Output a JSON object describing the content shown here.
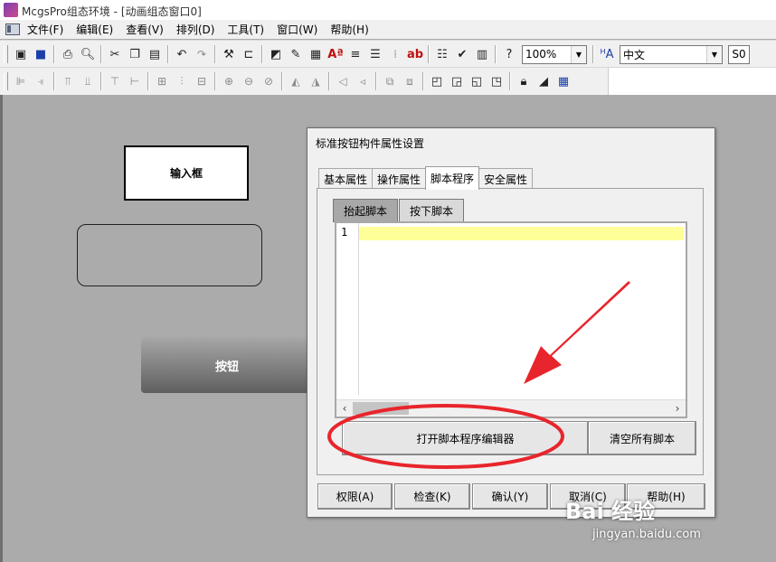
{
  "window": {
    "title": "McgsPro组态环境 - [动画组态窗口0]"
  },
  "menu": [
    "文件(F)",
    "编辑(E)",
    "查看(V)",
    "排列(D)",
    "工具(T)",
    "窗口(W)",
    "帮助(H)"
  ],
  "toolbar": {
    "zoom": "100%",
    "language": "中文",
    "so_label": "S0"
  },
  "canvas": {
    "input_box_label": "输入框",
    "button_label": "按钮"
  },
  "dialog": {
    "title": "标准按钮构件属性设置",
    "tabs": [
      "基本属性",
      "操作属性",
      "脚本程序",
      "安全属性"
    ],
    "active_tab": "脚本程序",
    "subtabs": [
      "抬起脚本",
      "按下脚本"
    ],
    "active_subtab": "抬起脚本",
    "line_number": "1",
    "open_editor_button": "打开脚本程序编辑器",
    "clear_scripts_button": "清空所有脚本",
    "buttons": {
      "permission": "权限(A)",
      "check": "检查(K)",
      "confirm": "确认(Y)",
      "cancel": "取消(C)",
      "help": "帮助(H)"
    }
  },
  "watermark": {
    "brand": "Bai 经验",
    "url": "jingyan.baidu.com"
  }
}
